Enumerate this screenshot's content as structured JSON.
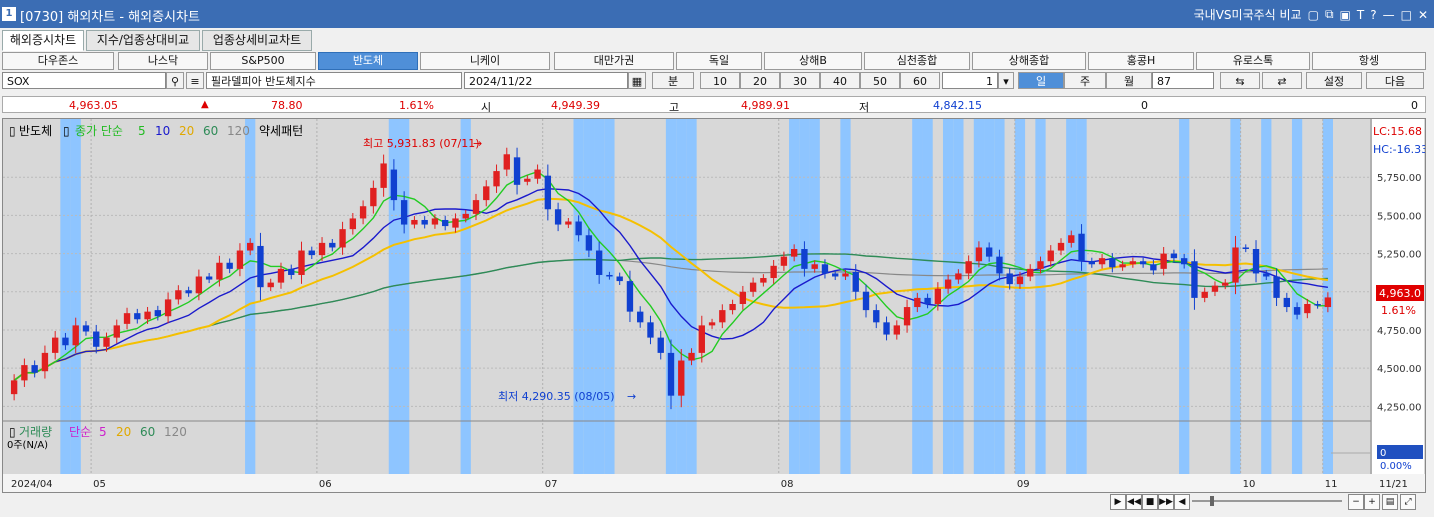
{
  "window": {
    "title": "[0730] 해외차트 - 해외증시차트",
    "right_label": "국내VS미국주식 비교",
    "icon_char": "1"
  },
  "tabs": [
    {
      "label": "해외증시차트",
      "active": true
    },
    {
      "label": "지수/업종상대비교",
      "active": false
    },
    {
      "label": "업종상세비교차트",
      "active": false
    }
  ],
  "markets": [
    {
      "label": "다우존스"
    },
    {
      "label": "나스닥"
    },
    {
      "label": "S&P500"
    },
    {
      "label": "반도체",
      "selected": true
    },
    {
      "label": "니케이"
    },
    {
      "label": "대만가권"
    },
    {
      "label": "독일"
    },
    {
      "label": "상해B"
    },
    {
      "label": "심천종합"
    },
    {
      "label": "상해종합"
    },
    {
      "label": "홍콩H"
    },
    {
      "label": "유로스톡"
    },
    {
      "label": "항셍"
    }
  ],
  "controls": {
    "symbol": "SOX",
    "symbol_name": "필라델피아 반도체지수",
    "date": "2024/11/22",
    "period_label": "분",
    "intervals": [
      "10",
      "20",
      "30",
      "40",
      "50",
      "60"
    ],
    "step_value": "1",
    "day": "일",
    "week": "주",
    "month": "월",
    "count": "87",
    "settings": "설정",
    "next": "다음"
  },
  "info": {
    "price": "4,963.05",
    "change": "78.80",
    "change_pct": "1.61%",
    "open_label": "시",
    "open": "4,949.39",
    "high_label": "고",
    "high": "4,989.91",
    "low_label": "저",
    "low": "4,842.15",
    "volume": "0",
    "amount": "0"
  },
  "chart": {
    "legend_name": "반도체",
    "legend_close": "종가 단순",
    "ma": [
      "5",
      "10",
      "20",
      "60",
      "120"
    ],
    "pattern": "약세패턴",
    "lc": "LC:15.68",
    "hc": "HC:-16.33",
    "high_note": "최고 5,931.83 (07/11)",
    "low_note": "최저 4,290.35 (08/05)",
    "price_tag": "4,963.0",
    "pct_tag": "1.61%",
    "vol_legend_name": "거래량",
    "vol_legend_simple": "단순",
    "vol_ma": [
      "5",
      "20",
      "60",
      "120"
    ],
    "vol_sub": "0주(N/A)",
    "vol_tag": "0",
    "vol_pct": "0.00%",
    "x_labels": [
      "2024/04",
      "05",
      "06",
      "07",
      "08",
      "09",
      "10",
      "11",
      "11/21"
    ],
    "y_ticks": [
      "5,750.00",
      "5,500.00",
      "5,250.00",
      "5,000.00",
      "4,750.00",
      "4,500.00",
      "4,250.00"
    ],
    "colors": {
      "up": "#e02020",
      "down": "#1040d0",
      "ma5": "#22cc22",
      "ma10": "#1a1acc",
      "ma20": "#f5c000",
      "ma60": "#2e8b57",
      "ma120": "#888888",
      "band": "#8ec5ff"
    }
  },
  "chart_data": {
    "type": "candlestick",
    "title": "",
    "ylim": [
      4200,
      6000
    ],
    "x_labels": [
      "2024/04",
      "05",
      "06",
      "07",
      "08",
      "09",
      "10",
      "11",
      "11/21"
    ],
    "candles": [
      [
        4330,
        4420
      ],
      [
        4420,
        4520
      ],
      [
        4520,
        4470
      ],
      [
        4480,
        4600
      ],
      [
        4600,
        4700
      ],
      [
        4700,
        4650
      ],
      [
        4650,
        4780
      ],
      [
        4780,
        4740
      ],
      [
        4740,
        4640
      ],
      [
        4640,
        4700
      ],
      [
        4700,
        4780
      ],
      [
        4790,
        4860
      ],
      [
        4860,
        4820
      ],
      [
        4820,
        4870
      ],
      [
        4880,
        4840
      ],
      [
        4840,
        4950
      ],
      [
        4950,
        5010
      ],
      [
        5010,
        4990
      ],
      [
        4990,
        5100
      ],
      [
        5100,
        5080
      ],
      [
        5080,
        5190
      ],
      [
        5190,
        5150
      ],
      [
        5150,
        5270
      ],
      [
        5270,
        5320
      ],
      [
        5300,
        5030
      ],
      [
        5030,
        5060
      ],
      [
        5060,
        5150
      ],
      [
        5150,
        5110
      ],
      [
        5110,
        5270
      ],
      [
        5270,
        5240
      ],
      [
        5240,
        5320
      ],
      [
        5320,
        5290
      ],
      [
        5290,
        5410
      ],
      [
        5410,
        5480
      ],
      [
        5480,
        5560
      ],
      [
        5560,
        5680
      ],
      [
        5680,
        5840
      ],
      [
        5800,
        5600
      ],
      [
        5600,
        5440
      ],
      [
        5440,
        5470
      ],
      [
        5470,
        5440
      ],
      [
        5440,
        5480
      ],
      [
        5470,
        5430
      ],
      [
        5420,
        5480
      ],
      [
        5480,
        5510
      ],
      [
        5510,
        5600
      ],
      [
        5600,
        5690
      ],
      [
        5690,
        5790
      ],
      [
        5800,
        5900
      ],
      [
        5880,
        5700
      ],
      [
        5720,
        5740
      ],
      [
        5740,
        5800
      ],
      [
        5760,
        5540
      ],
      [
        5540,
        5440
      ],
      [
        5440,
        5460
      ],
      [
        5460,
        5370
      ],
      [
        5370,
        5270
      ],
      [
        5270,
        5110
      ],
      [
        5110,
        5100
      ],
      [
        5100,
        5070
      ],
      [
        5070,
        4870
      ],
      [
        4870,
        4800
      ],
      [
        4800,
        4700
      ],
      [
        4700,
        4600
      ],
      [
        4600,
        4320
      ],
      [
        4320,
        4550
      ],
      [
        4550,
        4600
      ],
      [
        4600,
        4780
      ],
      [
        4780,
        4800
      ],
      [
        4800,
        4880
      ],
      [
        4880,
        4920
      ],
      [
        4920,
        5000
      ],
      [
        5000,
        5060
      ],
      [
        5060,
        5090
      ],
      [
        5090,
        5170
      ],
      [
        5170,
        5230
      ],
      [
        5230,
        5280
      ],
      [
        5280,
        5150
      ],
      [
        5150,
        5180
      ],
      [
        5180,
        5120
      ],
      [
        5120,
        5100
      ],
      [
        5100,
        5120
      ],
      [
        5130,
        5000
      ],
      [
        5000,
        4880
      ],
      [
        4880,
        4800
      ],
      [
        4800,
        4720
      ],
      [
        4720,
        4780
      ],
      [
        4780,
        4900
      ],
      [
        4900,
        4960
      ],
      [
        4960,
        4920
      ],
      [
        4920,
        5020
      ],
      [
        5020,
        5080
      ],
      [
        5080,
        5120
      ],
      [
        5120,
        5200
      ],
      [
        5200,
        5290
      ],
      [
        5290,
        5230
      ],
      [
        5230,
        5120
      ],
      [
        5120,
        5050
      ],
      [
        5050,
        5100
      ],
      [
        5100,
        5150
      ],
      [
        5150,
        5200
      ],
      [
        5200,
        5270
      ],
      [
        5270,
        5320
      ],
      [
        5320,
        5370
      ],
      [
        5380,
        5200
      ],
      [
        5200,
        5180
      ],
      [
        5180,
        5220
      ],
      [
        5220,
        5160
      ],
      [
        5160,
        5180
      ],
      [
        5180,
        5200
      ],
      [
        5200,
        5180
      ],
      [
        5180,
        5140
      ],
      [
        5150,
        5250
      ],
      [
        5250,
        5220
      ],
      [
        5220,
        5180
      ],
      [
        5200,
        4960
      ],
      [
        4960,
        5000
      ],
      [
        5000,
        5040
      ],
      [
        5040,
        5060
      ],
      [
        5060,
        5290
      ],
      [
        5290,
        5280
      ],
      [
        5280,
        5120
      ],
      [
        5120,
        5100
      ],
      [
        5100,
        4960
      ],
      [
        4960,
        4900
      ],
      [
        4900,
        4850
      ],
      [
        4860,
        4920
      ],
      [
        4920,
        4910
      ],
      [
        4900,
        4963
      ]
    ]
  }
}
